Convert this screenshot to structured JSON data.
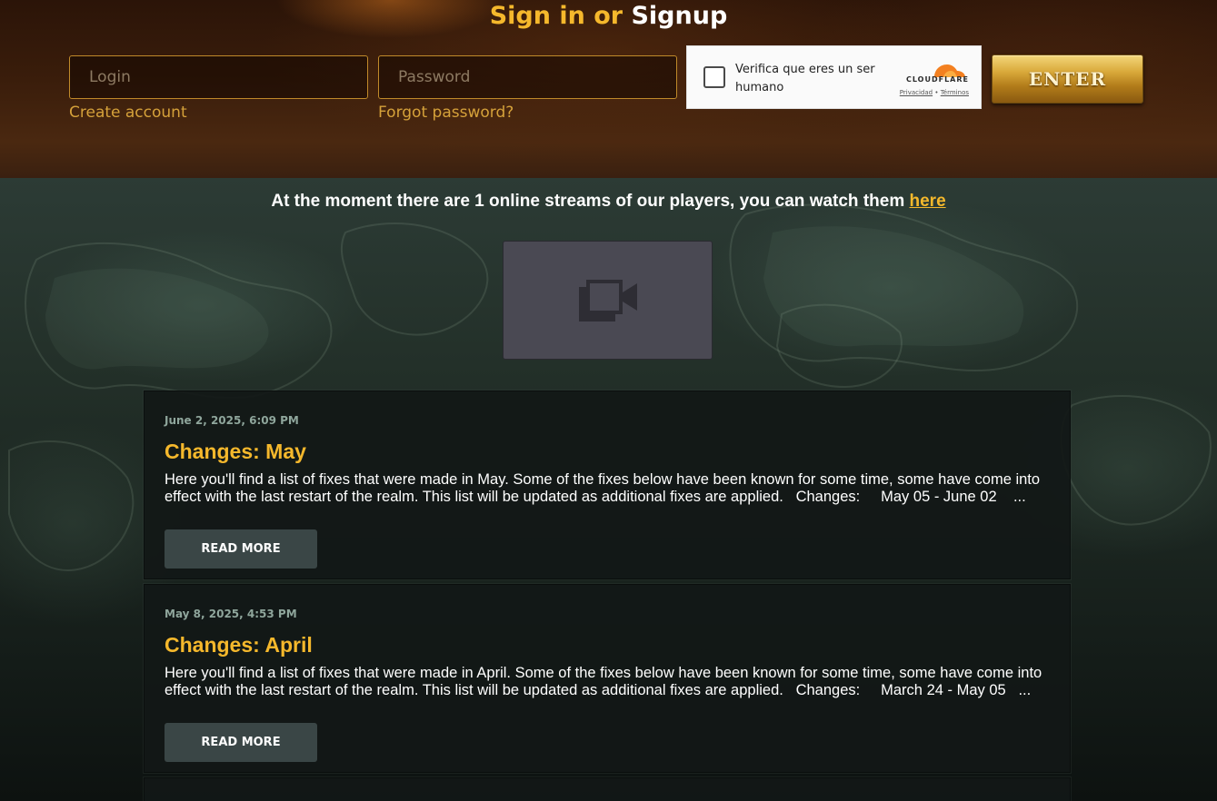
{
  "header": {
    "title_part1": "Sign in or",
    "title_part2": "Signup",
    "login_placeholder": "Login",
    "password_placeholder": "Password",
    "create_account": "Create account",
    "forgot_password": "Forgot password?",
    "enter_label": "ENTER"
  },
  "captcha": {
    "label": "Verifica que eres un ser humano",
    "brand": "CLOUDFLARE",
    "privacy": "Privacidad",
    "separator": "•",
    "terms": "Términos"
  },
  "streams": {
    "text": "At the moment there are 1 online streams of our players, you can watch them ",
    "link": "here"
  },
  "news": [
    {
      "date": "June 2, 2025, 6:09 PM",
      "title": "Changes: May",
      "excerpt": "Here you'll find a list of fixes that were made in May. Some of the fixes below have been known for some time, some have come into effect with the last restart of the realm. This list will be updated as additional fixes are applied.   Changes:     May 05 - June 02    ...",
      "button": "READ MORE"
    },
    {
      "date": "May 8, 2025, 4:53 PM",
      "title": "Changes: April",
      "excerpt": "Here you'll find a list of fixes that were made in April. Some of the fixes below have been known for some time, some have come into effect with the last restart of the realm. This list will be updated as additional fixes are applied.   Changes:     March 24 - May 05   ...",
      "button": "READ MORE"
    }
  ],
  "colors": {
    "accent_gold": "#f5b82c",
    "link_gold": "#d5a13a",
    "card_bg": "#121817",
    "button_bg": "#3a4646"
  },
  "icons": {
    "video": "video-camera-icon",
    "cloudflare": "cloudflare-cloud-icon"
  }
}
